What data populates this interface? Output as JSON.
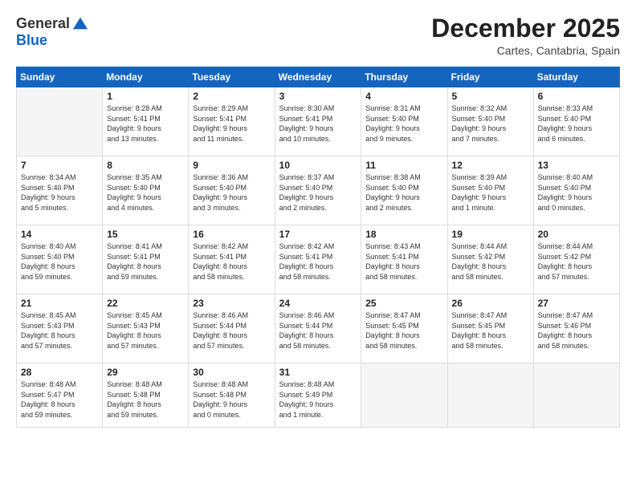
{
  "logo": {
    "general": "General",
    "blue": "Blue"
  },
  "title": "December 2025",
  "location": "Cartes, Cantabria, Spain",
  "days_of_week": [
    "Sunday",
    "Monday",
    "Tuesday",
    "Wednesday",
    "Thursday",
    "Friday",
    "Saturday"
  ],
  "weeks": [
    [
      {
        "day": "",
        "info": ""
      },
      {
        "day": "1",
        "info": "Sunrise: 8:28 AM\nSunset: 5:41 PM\nDaylight: 9 hours\nand 13 minutes."
      },
      {
        "day": "2",
        "info": "Sunrise: 8:29 AM\nSunset: 5:41 PM\nDaylight: 9 hours\nand 11 minutes."
      },
      {
        "day": "3",
        "info": "Sunrise: 8:30 AM\nSunset: 5:41 PM\nDaylight: 9 hours\nand 10 minutes."
      },
      {
        "day": "4",
        "info": "Sunrise: 8:31 AM\nSunset: 5:40 PM\nDaylight: 9 hours\nand 9 minutes."
      },
      {
        "day": "5",
        "info": "Sunrise: 8:32 AM\nSunset: 5:40 PM\nDaylight: 9 hours\nand 7 minutes."
      },
      {
        "day": "6",
        "info": "Sunrise: 8:33 AM\nSunset: 5:40 PM\nDaylight: 9 hours\nand 6 minutes."
      }
    ],
    [
      {
        "day": "7",
        "info": "Sunrise: 8:34 AM\nSunset: 5:40 PM\nDaylight: 9 hours\nand 5 minutes."
      },
      {
        "day": "8",
        "info": "Sunrise: 8:35 AM\nSunset: 5:40 PM\nDaylight: 9 hours\nand 4 minutes."
      },
      {
        "day": "9",
        "info": "Sunrise: 8:36 AM\nSunset: 5:40 PM\nDaylight: 9 hours\nand 3 minutes."
      },
      {
        "day": "10",
        "info": "Sunrise: 8:37 AM\nSunset: 5:40 PM\nDaylight: 9 hours\nand 2 minutes."
      },
      {
        "day": "11",
        "info": "Sunrise: 8:38 AM\nSunset: 5:40 PM\nDaylight: 9 hours\nand 2 minutes."
      },
      {
        "day": "12",
        "info": "Sunrise: 8:39 AM\nSunset: 5:40 PM\nDaylight: 9 hours\nand 1 minute."
      },
      {
        "day": "13",
        "info": "Sunrise: 8:40 AM\nSunset: 5:40 PM\nDaylight: 9 hours\nand 0 minutes."
      }
    ],
    [
      {
        "day": "14",
        "info": "Sunrise: 8:40 AM\nSunset: 5:40 PM\nDaylight: 8 hours\nand 59 minutes."
      },
      {
        "day": "15",
        "info": "Sunrise: 8:41 AM\nSunset: 5:41 PM\nDaylight: 8 hours\nand 59 minutes."
      },
      {
        "day": "16",
        "info": "Sunrise: 8:42 AM\nSunset: 5:41 PM\nDaylight: 8 hours\nand 58 minutes."
      },
      {
        "day": "17",
        "info": "Sunrise: 8:42 AM\nSunset: 5:41 PM\nDaylight: 8 hours\nand 58 minutes."
      },
      {
        "day": "18",
        "info": "Sunrise: 8:43 AM\nSunset: 5:41 PM\nDaylight: 8 hours\nand 58 minutes."
      },
      {
        "day": "19",
        "info": "Sunrise: 8:44 AM\nSunset: 5:42 PM\nDaylight: 8 hours\nand 58 minutes."
      },
      {
        "day": "20",
        "info": "Sunrise: 8:44 AM\nSunset: 5:42 PM\nDaylight: 8 hours\nand 57 minutes."
      }
    ],
    [
      {
        "day": "21",
        "info": "Sunrise: 8:45 AM\nSunset: 5:43 PM\nDaylight: 8 hours\nand 57 minutes."
      },
      {
        "day": "22",
        "info": "Sunrise: 8:45 AM\nSunset: 5:43 PM\nDaylight: 8 hours\nand 57 minutes."
      },
      {
        "day": "23",
        "info": "Sunrise: 8:46 AM\nSunset: 5:44 PM\nDaylight: 8 hours\nand 57 minutes."
      },
      {
        "day": "24",
        "info": "Sunrise: 8:46 AM\nSunset: 5:44 PM\nDaylight: 8 hours\nand 58 minutes."
      },
      {
        "day": "25",
        "info": "Sunrise: 8:47 AM\nSunset: 5:45 PM\nDaylight: 8 hours\nand 58 minutes."
      },
      {
        "day": "26",
        "info": "Sunrise: 8:47 AM\nSunset: 5:45 PM\nDaylight: 8 hours\nand 58 minutes."
      },
      {
        "day": "27",
        "info": "Sunrise: 8:47 AM\nSunset: 5:46 PM\nDaylight: 8 hours\nand 58 minutes."
      }
    ],
    [
      {
        "day": "28",
        "info": "Sunrise: 8:48 AM\nSunset: 5:47 PM\nDaylight: 8 hours\nand 59 minutes."
      },
      {
        "day": "29",
        "info": "Sunrise: 8:48 AM\nSunset: 5:48 PM\nDaylight: 8 hours\nand 59 minutes."
      },
      {
        "day": "30",
        "info": "Sunrise: 8:48 AM\nSunset: 5:48 PM\nDaylight: 9 hours\nand 0 minutes."
      },
      {
        "day": "31",
        "info": "Sunrise: 8:48 AM\nSunset: 5:49 PM\nDaylight: 9 hours\nand 1 minute."
      },
      {
        "day": "",
        "info": ""
      },
      {
        "day": "",
        "info": ""
      },
      {
        "day": "",
        "info": ""
      }
    ]
  ]
}
